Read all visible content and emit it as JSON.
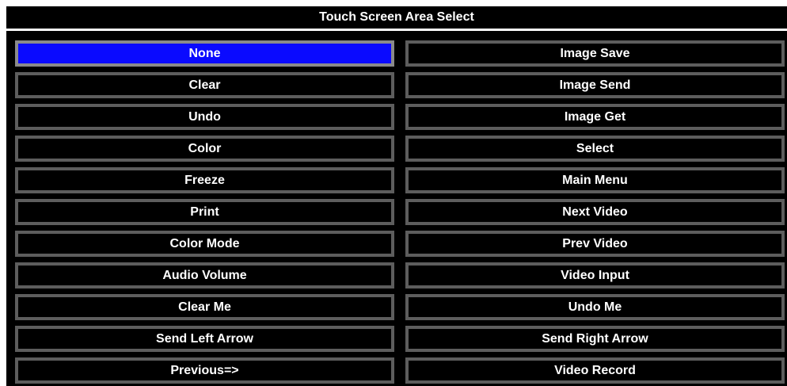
{
  "title": "Touch Screen Area Select",
  "colors": {
    "background": "#000000",
    "button_border": "#5d5d5d",
    "selected": "#0a0aff",
    "text": "#ffffff"
  },
  "selected_item": "None",
  "left_column": [
    "None",
    "Clear",
    "Undo",
    "Color",
    "Freeze",
    "Print",
    "Color Mode",
    "Audio Volume",
    "Clear Me",
    "Send Left Arrow",
    "Previous=>"
  ],
  "right_column": [
    "Image Save",
    "Image Send",
    "Image Get",
    "Select",
    "Main Menu",
    "Next Video",
    "Prev Video",
    "Video Input",
    "Undo Me",
    "Send Right Arrow",
    "Video Record"
  ]
}
